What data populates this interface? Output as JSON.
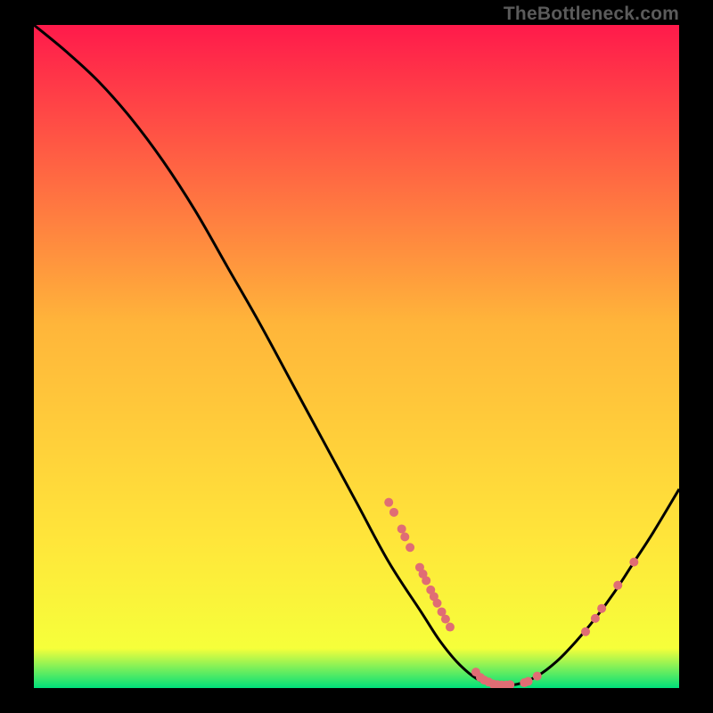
{
  "watermark": "TheBottleneck.com",
  "chart_data": {
    "type": "line",
    "title": "",
    "xlabel": "",
    "ylabel": "",
    "xlim": [
      0,
      100
    ],
    "ylim": [
      0,
      100
    ],
    "gradient": {
      "top": "#ff1a4b",
      "mid1": "#ff8a3a",
      "mid2": "#ffe63a",
      "bottom": "#00e07a"
    },
    "curve": [
      {
        "x": 0.0,
        "y": 100.0
      },
      {
        "x": 5.0,
        "y": 96.0
      },
      {
        "x": 10.0,
        "y": 91.5
      },
      {
        "x": 15.0,
        "y": 86.0
      },
      {
        "x": 20.0,
        "y": 79.5
      },
      {
        "x": 25.0,
        "y": 72.0
      },
      {
        "x": 30.0,
        "y": 63.5
      },
      {
        "x": 35.0,
        "y": 55.0
      },
      {
        "x": 40.0,
        "y": 46.0
      },
      {
        "x": 45.0,
        "y": 37.0
      },
      {
        "x": 50.0,
        "y": 28.0
      },
      {
        "x": 55.0,
        "y": 19.0
      },
      {
        "x": 60.0,
        "y": 11.5
      },
      {
        "x": 63.0,
        "y": 7.0
      },
      {
        "x": 66.0,
        "y": 3.5
      },
      {
        "x": 69.0,
        "y": 1.2
      },
      {
        "x": 72.0,
        "y": 0.4
      },
      {
        "x": 75.0,
        "y": 0.6
      },
      {
        "x": 78.0,
        "y": 1.8
      },
      {
        "x": 81.0,
        "y": 4.0
      },
      {
        "x": 84.0,
        "y": 7.0
      },
      {
        "x": 87.0,
        "y": 10.5
      },
      {
        "x": 90.0,
        "y": 14.5
      },
      {
        "x": 93.0,
        "y": 19.0
      },
      {
        "x": 96.0,
        "y": 23.5
      },
      {
        "x": 100.0,
        "y": 30.0
      }
    ],
    "markers": [
      {
        "x": 55.0,
        "y": 28.0,
        "r": 5
      },
      {
        "x": 55.8,
        "y": 26.5,
        "r": 5
      },
      {
        "x": 57.0,
        "y": 24.0,
        "r": 5
      },
      {
        "x": 57.5,
        "y": 22.8,
        "r": 5
      },
      {
        "x": 58.3,
        "y": 21.2,
        "r": 5
      },
      {
        "x": 59.8,
        "y": 18.2,
        "r": 5
      },
      {
        "x": 60.3,
        "y": 17.2,
        "r": 5
      },
      {
        "x": 60.8,
        "y": 16.2,
        "r": 5
      },
      {
        "x": 61.5,
        "y": 14.8,
        "r": 5
      },
      {
        "x": 62.0,
        "y": 13.8,
        "r": 5
      },
      {
        "x": 62.5,
        "y": 12.8,
        "r": 5
      },
      {
        "x": 63.2,
        "y": 11.5,
        "r": 5
      },
      {
        "x": 63.8,
        "y": 10.4,
        "r": 5
      },
      {
        "x": 64.5,
        "y": 9.2,
        "r": 5
      },
      {
        "x": 68.5,
        "y": 2.4,
        "r": 5
      },
      {
        "x": 69.2,
        "y": 1.6,
        "r": 5
      },
      {
        "x": 69.8,
        "y": 1.2,
        "r": 5
      },
      {
        "x": 70.5,
        "y": 0.9,
        "r": 5
      },
      {
        "x": 71.2,
        "y": 0.6,
        "r": 5
      },
      {
        "x": 71.8,
        "y": 0.5,
        "r": 5
      },
      {
        "x": 72.5,
        "y": 0.45,
        "r": 5
      },
      {
        "x": 73.2,
        "y": 0.45,
        "r": 5
      },
      {
        "x": 73.8,
        "y": 0.5,
        "r": 5
      },
      {
        "x": 76.0,
        "y": 0.8,
        "r": 5
      },
      {
        "x": 76.6,
        "y": 1.0,
        "r": 5
      },
      {
        "x": 78.0,
        "y": 1.8,
        "r": 5
      },
      {
        "x": 85.5,
        "y": 8.5,
        "r": 5
      },
      {
        "x": 87.0,
        "y": 10.5,
        "r": 5
      },
      {
        "x": 88.0,
        "y": 12.0,
        "r": 5
      },
      {
        "x": 90.5,
        "y": 15.5,
        "r": 5
      },
      {
        "x": 93.0,
        "y": 19.0,
        "r": 5
      }
    ],
    "marker_color": "#e06d74",
    "curve_color": "#000000",
    "curve_width": 3
  }
}
